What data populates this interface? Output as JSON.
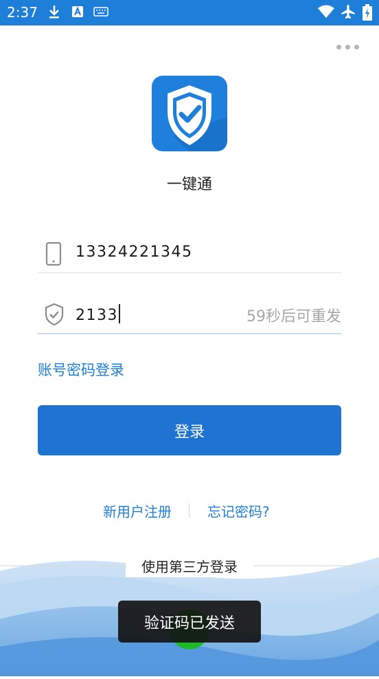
{
  "status_bar": {
    "time": "2:37",
    "left_icons": [
      "download-icon",
      "text-input-icon",
      "keyboard-icon"
    ],
    "right_icons": [
      "wifi-icon",
      "airplane-mode-icon",
      "battery-charging-icon"
    ]
  },
  "header": {
    "menu_icon": "more-horizontal-icon"
  },
  "app": {
    "name": "一键通",
    "logo_icon": "shield-check-icon",
    "brand_color": "#1e7fd9"
  },
  "form": {
    "phone": {
      "icon": "phone-icon",
      "value": "13324221345"
    },
    "code": {
      "icon": "shield-check-outline-icon",
      "value": "2133",
      "resend_label": "59秒后可重发"
    },
    "account_login_link": "账号密码登录",
    "login_button": "登录"
  },
  "links": {
    "register": "新用户注册",
    "forgot_password": "忘记密码?"
  },
  "third_party": {
    "label": "使用第三方登录",
    "icon": "wechat-icon"
  },
  "toast": {
    "message": "验证码已发送"
  }
}
